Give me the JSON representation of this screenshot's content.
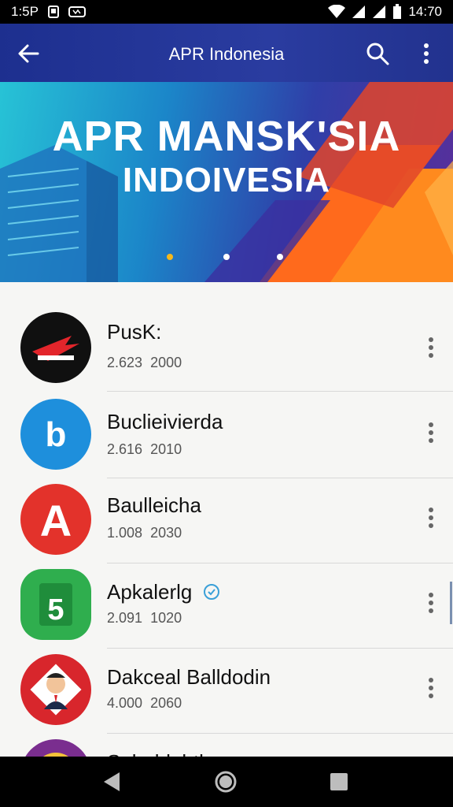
{
  "status_bar": {
    "left_time": "1:5P",
    "right_time": "14:70"
  },
  "app_bar": {
    "title": "APR Indonesia"
  },
  "banner": {
    "line1": "APR MANSK'SIA",
    "line2": "INDOIVESIA"
  },
  "apps": [
    {
      "name": "PusK:",
      "meta1": "2.623",
      "meta2": "2000",
      "icon": "red-arrow-app-icon",
      "icon_bg": "#101010"
    },
    {
      "name": "Buclieivierda",
      "meta1": "2.616",
      "meta2": "2010",
      "icon": "blue-b-app-icon",
      "icon_bg": "#1e8fdc"
    },
    {
      "name": "Baulleicha",
      "meta1": "1.008",
      "meta2": "2030",
      "icon": "red-a-app-icon",
      "icon_bg": "#e3322b"
    },
    {
      "name": "Apkalerlg",
      "meta1": "2.091",
      "meta2": "1020",
      "icon": "green-bag-app-icon",
      "icon_bg": "#2fae4e"
    },
    {
      "name": "Dakceal Balldodin",
      "meta1": "4.000",
      "meta2": "2060",
      "icon": "cartoon-man-app-icon",
      "icon_bg": "#d8262c"
    },
    {
      "name": "Sabaldabtla",
      "meta1": "",
      "meta2": "",
      "icon": "purple-app-icon",
      "icon_bg": "#7a2e8f"
    }
  ]
}
